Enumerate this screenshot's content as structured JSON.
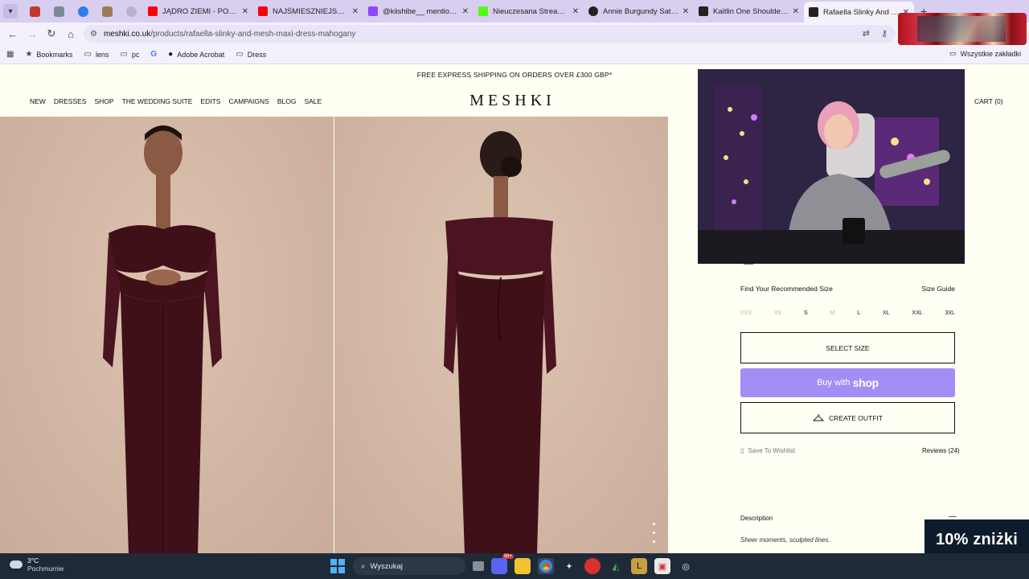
{
  "browser": {
    "tabs": [
      {
        "title": "JĄDRO ZIEMI - POWAŻNE",
        "favicon_color": "#ff0000"
      },
      {
        "title": "NAJŚMIESZNIEJSZE MOM",
        "favicon_color": "#ff0000"
      },
      {
        "title": "@kiishibe__ mentioned",
        "favicon_color": "#9146ff"
      },
      {
        "title": "Nieuczesana Stream - Wi",
        "favicon_color": "#53fc18"
      },
      {
        "title": "Annie Burgundy Satin Ba",
        "favicon_color": "#222222"
      },
      {
        "title": "Kaitlin One Shoulder Slin",
        "favicon_color": "#222222"
      },
      {
        "title": "Rafaella Slinky And Mesh",
        "favicon_color": "#222222",
        "active": true
      }
    ],
    "url_host": "meshki.co.uk",
    "url_path": "/products/rafaella-slinky-and-mesh-maxi-dress-mahogany",
    "bookmarks": [
      "Bookmarks",
      "lens",
      "pc",
      "Adobe Acrobat",
      "Dress"
    ],
    "bookmarks_right": "Wszystkie zakładki"
  },
  "site": {
    "promo": "FREE EXPRESS SHIPPING ON ORDERS OVER £300 GBP*",
    "logo": "MESHKI",
    "nav": [
      "NEW",
      "DRESSES",
      "SHOP",
      "THE WEDDING SUITE",
      "EDITS",
      "CAMPAIGNS",
      "BLOG",
      "SALE"
    ],
    "cart": "CART (0)",
    "product_color": "#3f1018"
  },
  "product": {
    "size_label": "Find Your Recommended Size",
    "size_guide": "Size Guide",
    "sizes": [
      {
        "label": "XXS",
        "available": false
      },
      {
        "label": "XS",
        "available": false
      },
      {
        "label": "S",
        "available": true
      },
      {
        "label": "M",
        "available": false
      },
      {
        "label": "L",
        "available": true
      },
      {
        "label": "XL",
        "available": true
      },
      {
        "label": "XXL",
        "available": true
      },
      {
        "label": "3XL",
        "available": true
      }
    ],
    "select_size": "SELECT SIZE",
    "buy_with": "Buy with",
    "shop_word": "shop",
    "create_outfit": "CREATE OUTFIT",
    "wishlist": "Save To Wishlist",
    "reviews": "Reviews (24)",
    "description_title": "Description",
    "description_toggle": "—",
    "description_text": "Sheer moments, sculpted lines."
  },
  "popup": {
    "discount": "10% zniżki"
  },
  "taskbar": {
    "temp": "3°C",
    "weather": "Pochmurnie",
    "search": "Wyszukaj",
    "badge": "99+"
  },
  "colors": {
    "shop_button": "#a38ef6",
    "page_bg": "#fffff4",
    "tab_bar": "#d8cef0"
  }
}
